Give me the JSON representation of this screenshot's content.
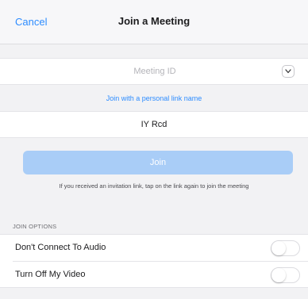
{
  "header": {
    "cancel_label": "Cancel",
    "title": "Join a Meeting"
  },
  "meeting_id": {
    "value": "",
    "placeholder": "Meeting ID",
    "dropdown_icon": "chevron-down-icon"
  },
  "personal_link_label": "Join with a personal link name",
  "name_field": {
    "value": "IY Rcd"
  },
  "join_button": {
    "label": "Join",
    "enabled": false
  },
  "invite_hint": "If you received an invitation link, tap on the link again to join the meeting",
  "join_options": {
    "header": "JOIN OPTIONS",
    "items": [
      {
        "label": "Don't Connect To Audio",
        "on": false
      },
      {
        "label": "Turn Off My Video",
        "on": false
      }
    ]
  },
  "colors": {
    "accent": "#2d8cff",
    "join_disabled": "#a9cdf7",
    "background": "#f2f2f4"
  }
}
